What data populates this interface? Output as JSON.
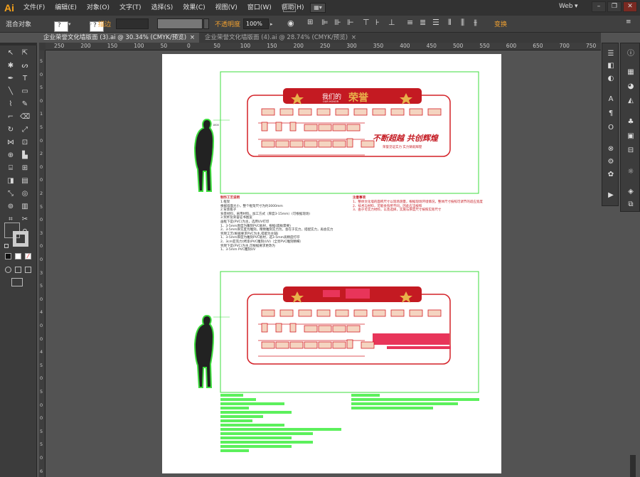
{
  "app": {
    "logo": "Ai",
    "menus": [
      "文件(F)",
      "编辑(E)",
      "对象(O)",
      "文字(T)",
      "选择(S)",
      "效果(C)",
      "视图(V)",
      "窗口(W)",
      "帮助(H)"
    ],
    "workspace": "Web",
    "window_controls": {
      "minimize": "–",
      "restore": "❐",
      "close": "✕"
    }
  },
  "control_bar": {
    "selection_label": "混合对象",
    "stroke_label": "描边",
    "opacity_label": "不透明度",
    "opacity_value": "100%",
    "transform_label": "变换"
  },
  "tabs": [
    {
      "label": "企业荣誉文化墙版面 (3).ai @ 30.34% (CMYK/预览)",
      "close": "×",
      "active": true
    },
    {
      "label": "企业荣誉文化墙版面 (4).ai @ 28.74% (CMYK/预览)",
      "close": "×",
      "active": false
    }
  ],
  "ruler": {
    "h_ticks": [
      "250",
      "200",
      "150",
      "100",
      "50",
      "0",
      "50",
      "100",
      "150",
      "200",
      "250",
      "300",
      "350",
      "400",
      "450",
      "500",
      "550",
      "600",
      "650",
      "700",
      "750"
    ],
    "v_ticks": [
      "5",
      "0",
      "5",
      "0",
      "1",
      "5",
      "0",
      "2",
      "0",
      "0",
      "2",
      "5",
      "0",
      "3",
      "0",
      "0",
      "3",
      "5",
      "0",
      "4",
      "0",
      "0",
      "4",
      "5",
      "0",
      "5",
      "0",
      "0",
      "5",
      "5",
      "0",
      "6"
    ]
  },
  "design": {
    "banner_title": "我们的",
    "banner_title_big": "荣誉",
    "banner_subtitle": "OUR HONOR",
    "slogan": "不断超越 共创辉煌",
    "slogan_sub": "荣誉见证实力 实力铸就辉煌",
    "notes_left_title": "制作工艺说明",
    "notes_right_title": "注意事项",
    "notes_left": [
      "1.框架",
      "根据墙面大小，整个框架尺寸为约3000mm",
      "2.背景板子",
      "背景材料，采用材料，加工方式（厚度3-15mm）(可根据现场)",
      "3.奖杯及荣誉证书图案",
      "画框下是(PVC)为主，选用UV打印",
      "1、3-5mm厚度为雕刻PVC板材，根据(面板需要)",
      "2、3-5mm厚实度为雕刻，精致雕刻实力为，会在于实力，搭配实力，再会实力",
      "奖牌工艺(根据要求PVC为主,搭配为主辅)",
      "1、3-5mm厚度为雕刻PVC板材，选3-5mm高精度打印",
      "2、3cm亚克力(烤漆)PVC雕刻(UV)（全亮PVC雕刻精细）",
      "奖牌下是(PVC)为主,可根据要求更改为",
      "1、3-5mm PVC雕刻UV"
    ],
    "notes_right": [
      "1、整体文化墙的面积尺寸以现场测量，根据现场环境情况，整体尺寸按照可调节的适应宽度",
      "2、技术与材料，可能会有所不同，因此应当按照",
      "3、由于可实力材料，以及选择，实施与厚度尺寸按照实际尺寸"
    ],
    "person_label": "1800"
  },
  "colors": {
    "accent": "#d42027",
    "gold": "#e8b04a",
    "selection": "#3ddc3d",
    "ai_orange": "#f7a21b"
  }
}
